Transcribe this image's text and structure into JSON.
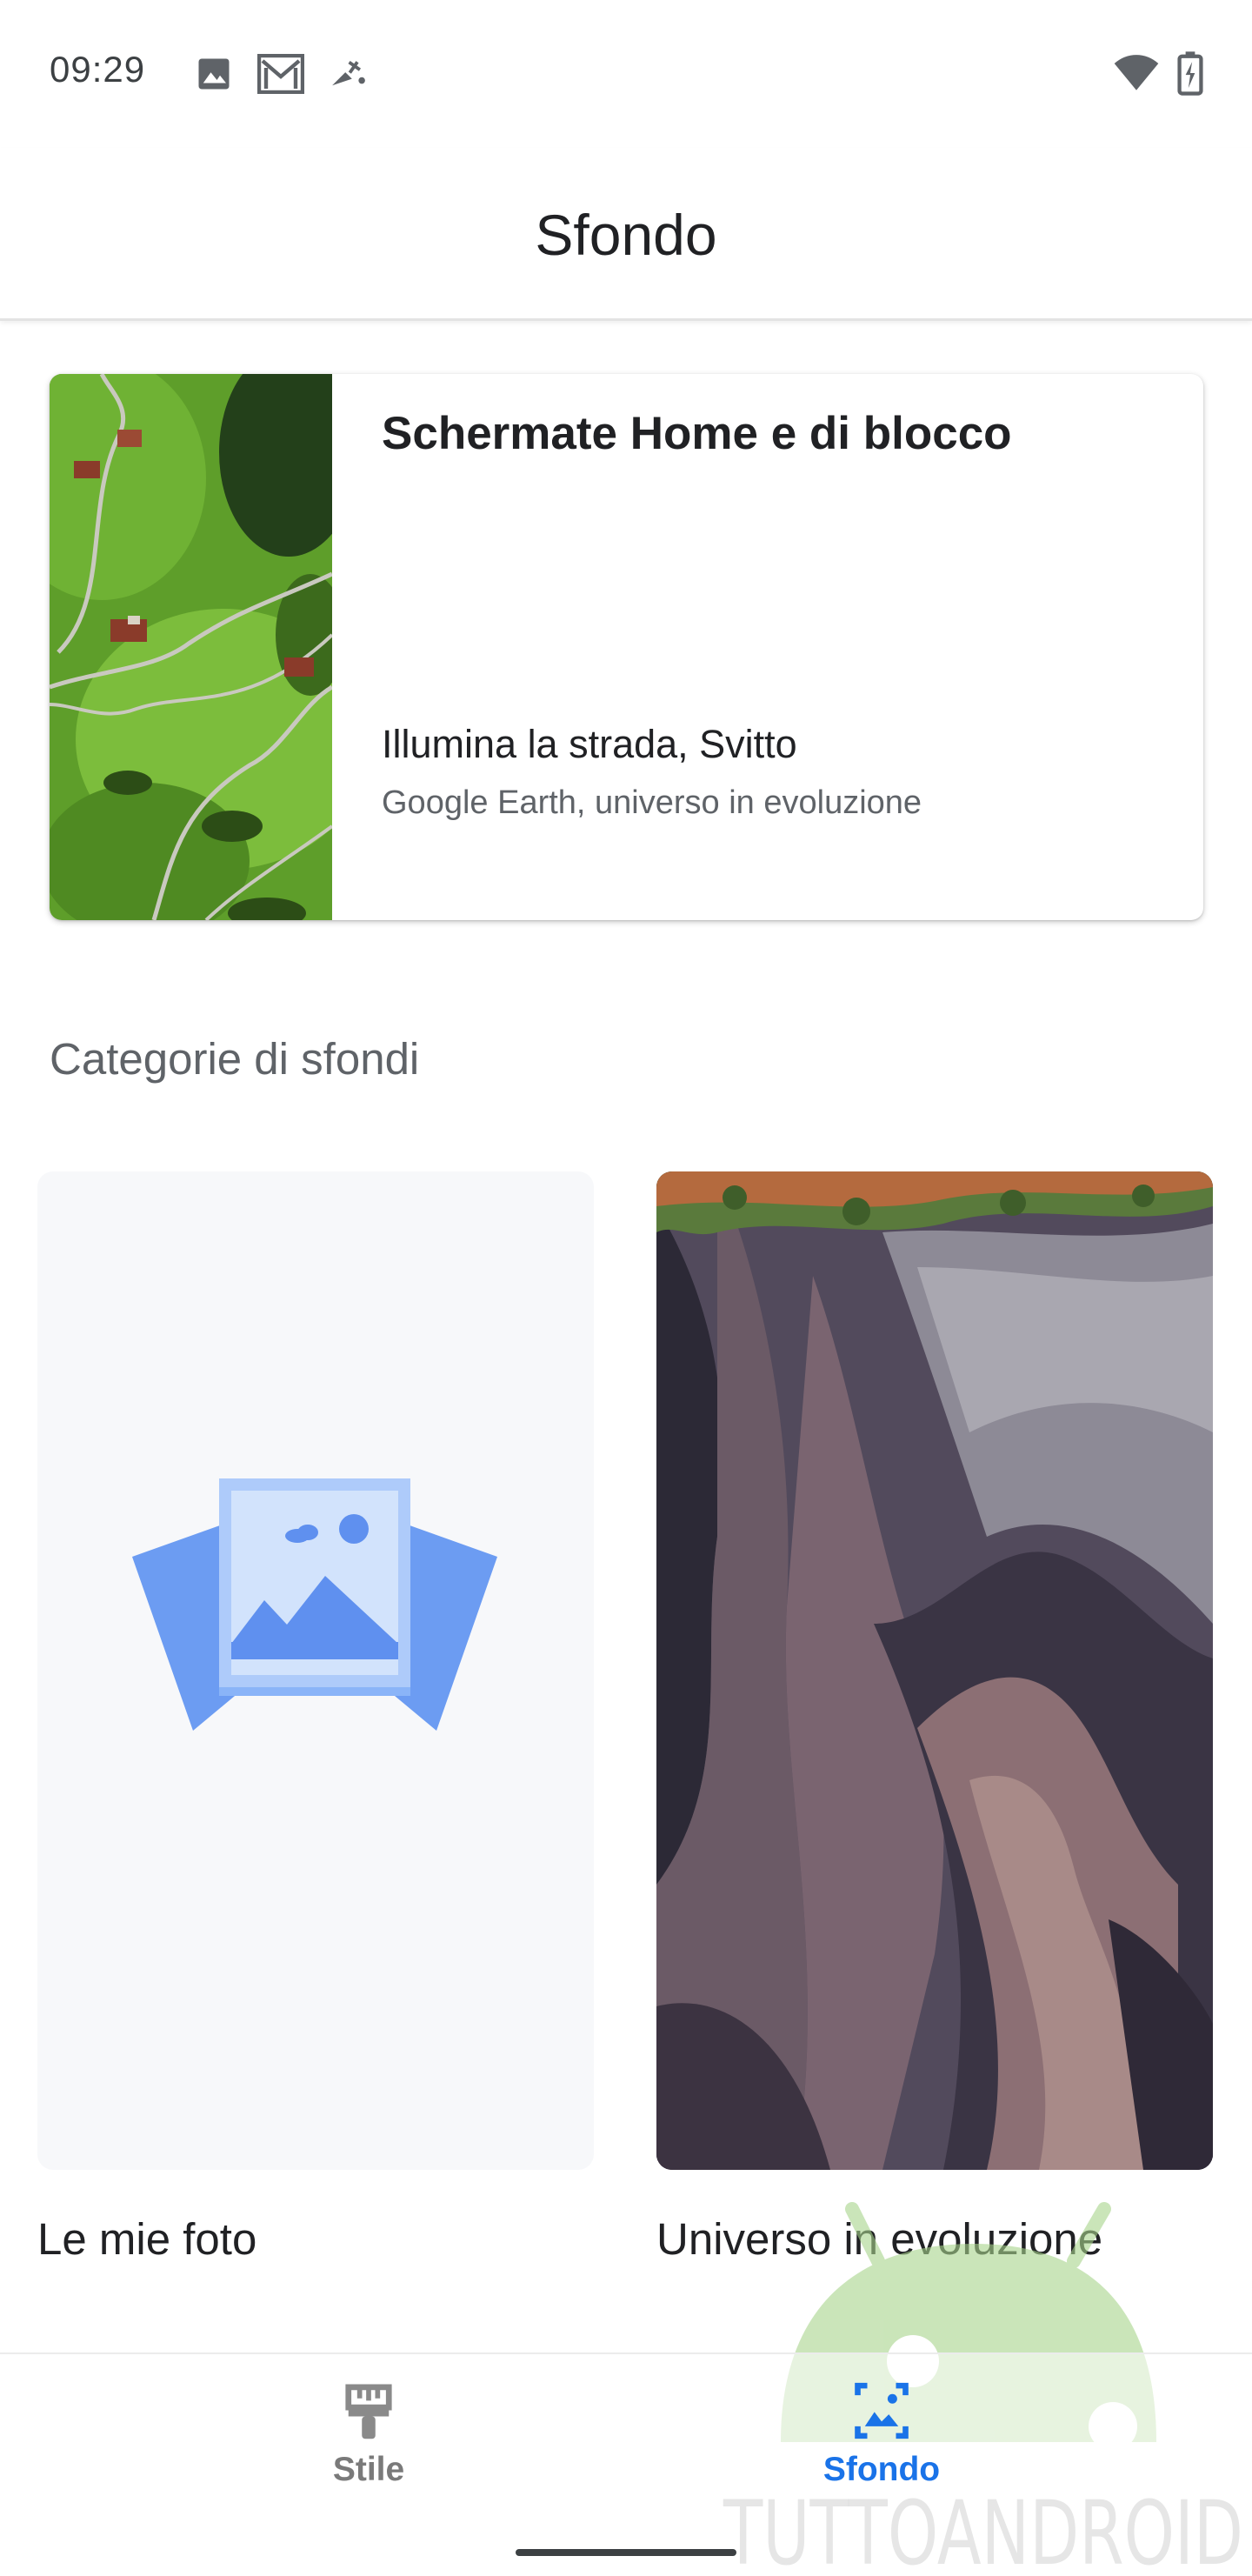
{
  "status_bar": {
    "time": "09:29",
    "icons": [
      "image-icon",
      "gmail-icon",
      "satellite-icon",
      "wifi-icon",
      "battery-charging-icon"
    ]
  },
  "app_bar": {
    "title": "Sfondo"
  },
  "current_wallpaper": {
    "heading": "Schermate Home e di blocco",
    "name": "Illumina la strada, Svitto",
    "attribution": "Google Earth, universo in evoluzione"
  },
  "categories": {
    "section_title": "Categorie di sfondi",
    "items": [
      {
        "label": "Le mie foto",
        "icon": "my-photos-icon"
      },
      {
        "label": "Universo in evoluzione",
        "icon": "rock-formation-photo"
      }
    ]
  },
  "bottom_nav": {
    "items": [
      {
        "label": "Stile",
        "icon": "brush-icon",
        "selected": false
      },
      {
        "label": "Sfondo",
        "icon": "wallpaper-icon",
        "selected": true
      }
    ]
  },
  "watermark": {
    "text": "TUTTOANDROID"
  },
  "colors": {
    "accent": "#1a73e8",
    "inactive": "#757575",
    "photo_icon_dark": "#6c9cf2",
    "photo_icon_light": "#d2e3fc"
  }
}
